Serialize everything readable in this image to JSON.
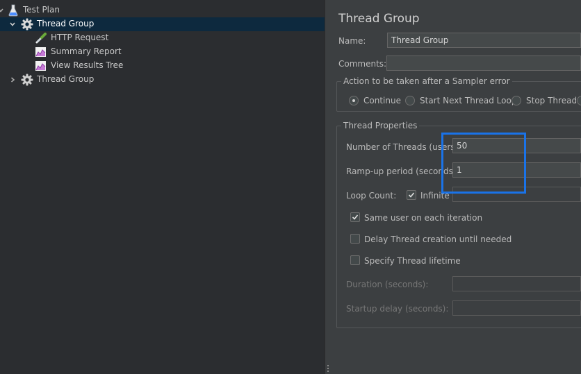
{
  "tree": {
    "test_plan": "Test Plan",
    "thread_group_1": "Thread Group",
    "http_request": "HTTP Request",
    "summary_report": "Summary Report",
    "view_results_tree": "View Results Tree",
    "thread_group_2": "Thread Group"
  },
  "editor": {
    "title": "Thread Group",
    "name_label": "Name:",
    "name_value": "Thread Group",
    "comments_label": "Comments:",
    "comments_value": "",
    "sampler_error": {
      "title": "Action to be taken after a Sampler error",
      "options": [
        "Continue",
        "Start Next Thread Loop",
        "Stop Thread"
      ],
      "selected": "Continue"
    },
    "thread_props": {
      "title": "Thread Properties",
      "num_threads_label": "Number of Threads (users):",
      "num_threads_value": "50",
      "rampup_label": "Ramp-up period (seconds):",
      "rampup_value": "1",
      "loop_label": "Loop Count:",
      "infinite_label": "Infinite",
      "infinite_checked": true,
      "same_user_label": "Same user on each iteration",
      "same_user_checked": true,
      "delay_label": "Delay Thread creation until needed",
      "delay_checked": false,
      "lifetime_label": "Specify Thread lifetime",
      "lifetime_checked": false,
      "duration_label": "Duration (seconds):",
      "startup_label": "Startup delay (seconds):"
    }
  },
  "colors": {
    "tree_bg": "#2b2d30",
    "panel_bg": "#3c3f41",
    "selection": "#0d293e",
    "highlight_box": "#1a73e8"
  }
}
